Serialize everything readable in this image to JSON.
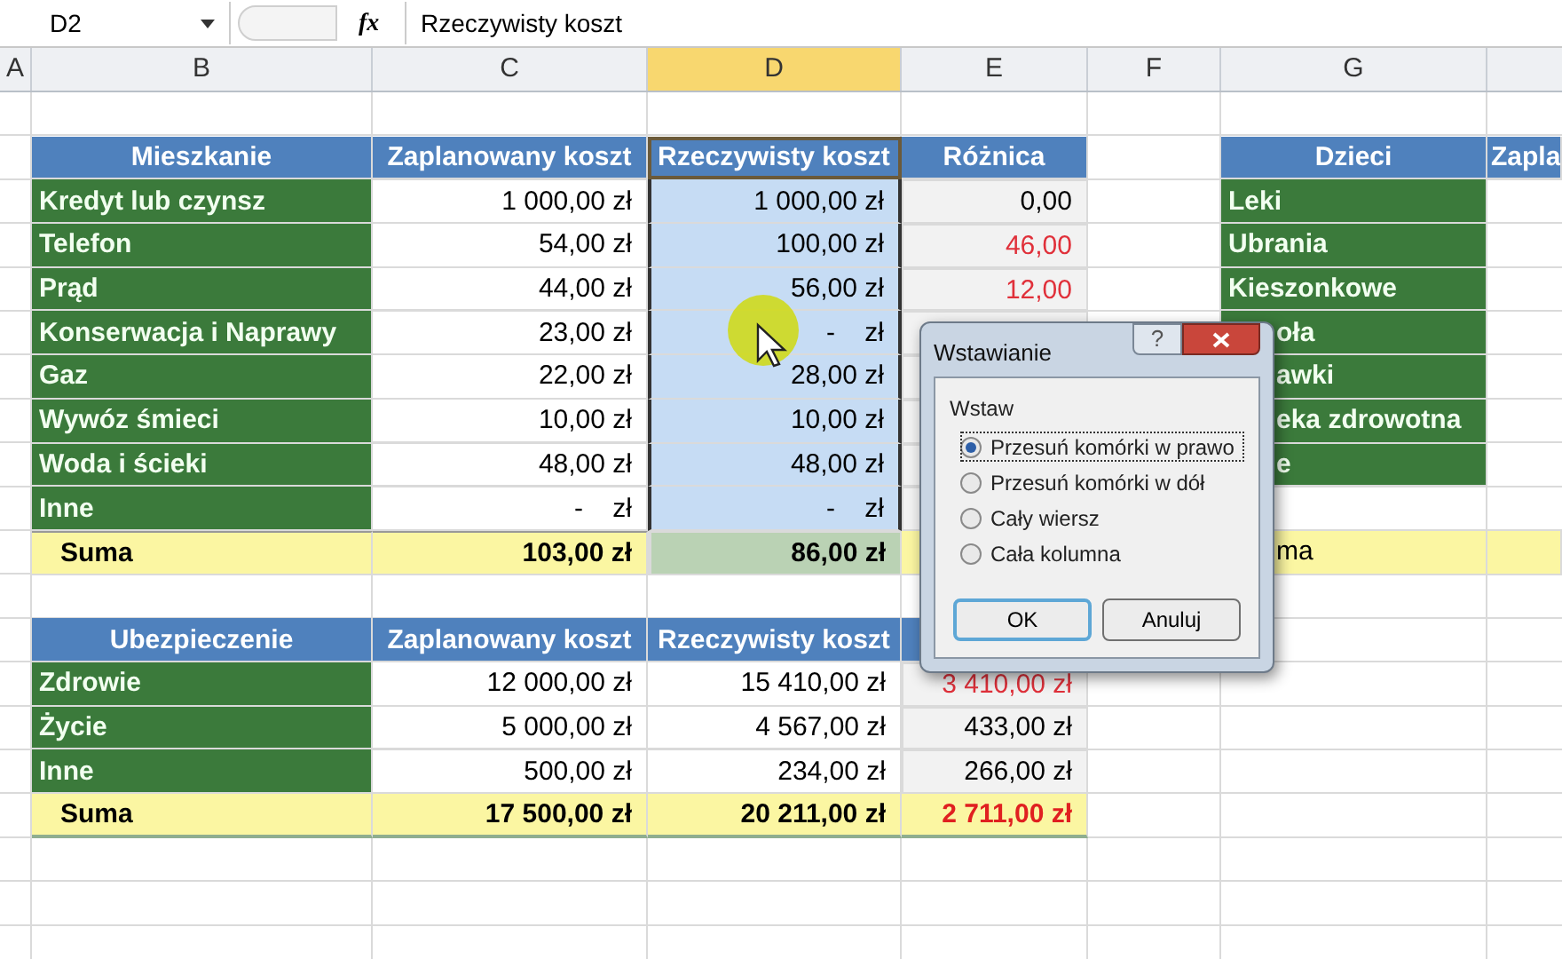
{
  "formula_bar": {
    "name_box": "D2",
    "function_label": "fx",
    "formula": "Rzeczywisty koszt"
  },
  "column_headers": [
    {
      "label": "A",
      "selected": false
    },
    {
      "label": "B",
      "selected": false
    },
    {
      "label": "C",
      "selected": false
    },
    {
      "label": "D",
      "selected": true
    },
    {
      "label": "E",
      "selected": false
    },
    {
      "label": "F",
      "selected": false
    },
    {
      "label": "G",
      "selected": false
    }
  ],
  "table_1": {
    "headers": [
      "Mieszkanie",
      "Zaplanowany koszt",
      "Rzeczywisty koszt",
      "Różnica"
    ],
    "rows": [
      {
        "label": "Kredyt lub czynsz",
        "planned": "1 000,00 zł",
        "actual": "1 000,00 zł",
        "difference": "0,00",
        "over_budget": false
      },
      {
        "label": "Telefon",
        "planned": "54,00 zł",
        "actual": "100,00 zł",
        "difference": "46,00",
        "over_budget": true
      },
      {
        "label": "Prąd",
        "planned": "44,00 zł",
        "actual": "56,00 zł",
        "difference": "12,00",
        "over_budget": true
      },
      {
        "label": "Konserwacja i Naprawy",
        "planned": "23,00 zł",
        "actual": "-    zł"
      },
      {
        "label": "Gaz",
        "planned": "22,00 zł",
        "actual": "28,00 zł"
      },
      {
        "label": "Wywóz śmieci",
        "planned": "10,00 zł",
        "actual": "10,00 zł"
      },
      {
        "label": "Woda i ścieki",
        "planned": "48,00 zł",
        "actual": "48,00 zł"
      },
      {
        "label": "Inne",
        "planned": "-    zł",
        "actual": "-    zł"
      }
    ],
    "total": {
      "label": "Suma",
      "planned": "103,00 zł",
      "actual": "86,00 zł"
    }
  },
  "table_2": {
    "headers": [
      "Ubezpieczenie",
      "Zaplanowany koszt",
      "Rzeczywisty koszt"
    ],
    "rows": [
      {
        "label": "Zdrowie",
        "planned": "12 000,00 zł",
        "actual": "15 410,00 zł",
        "difference": "3 410,00 zł",
        "over_budget": true
      },
      {
        "label": "Życie",
        "planned": "5 000,00 zł",
        "actual": "4 567,00 zł",
        "difference": "433,00 zł",
        "over_budget": false
      },
      {
        "label": "Inne",
        "planned": "500,00 zł",
        "actual": "234,00 zł",
        "difference": "266,00 zł",
        "over_budget": false
      }
    ],
    "total": {
      "label": "Suma",
      "planned": "17 500,00 zł",
      "actual": "20 211,00 zł",
      "difference": "2 711,00 zł",
      "over_budget": true
    }
  },
  "table_3": {
    "headers": [
      "Dzieci",
      "Zapla"
    ],
    "rows": [
      {
        "label": "Leki",
        "kind": "whole"
      },
      {
        "label": "Ubrania",
        "kind": "whole"
      },
      {
        "label": "Kieszonkowe",
        "kind": "whole"
      },
      {
        "label": "oła",
        "kind": "clipped"
      },
      {
        "label": "awki",
        "kind": "clipped"
      },
      {
        "label": "eka zdrowotna",
        "kind": "clipped"
      },
      {
        "label": "e",
        "kind": "clipped"
      }
    ],
    "total": {
      "label": "ma",
      "kind": "clipped"
    }
  },
  "dialog": {
    "title": "Wstawianie",
    "help_button": "?",
    "group_label": "Wstaw",
    "options": [
      {
        "label": "Przesuń komórki w prawo",
        "selected": true
      },
      {
        "label": "Przesuń komórki w dół",
        "selected": false
      },
      {
        "label": "Cały wiersz",
        "selected": false
      },
      {
        "label": "Cała kolumna",
        "selected": false
      }
    ],
    "buttons": [
      "OK",
      "Anuluj"
    ]
  }
}
